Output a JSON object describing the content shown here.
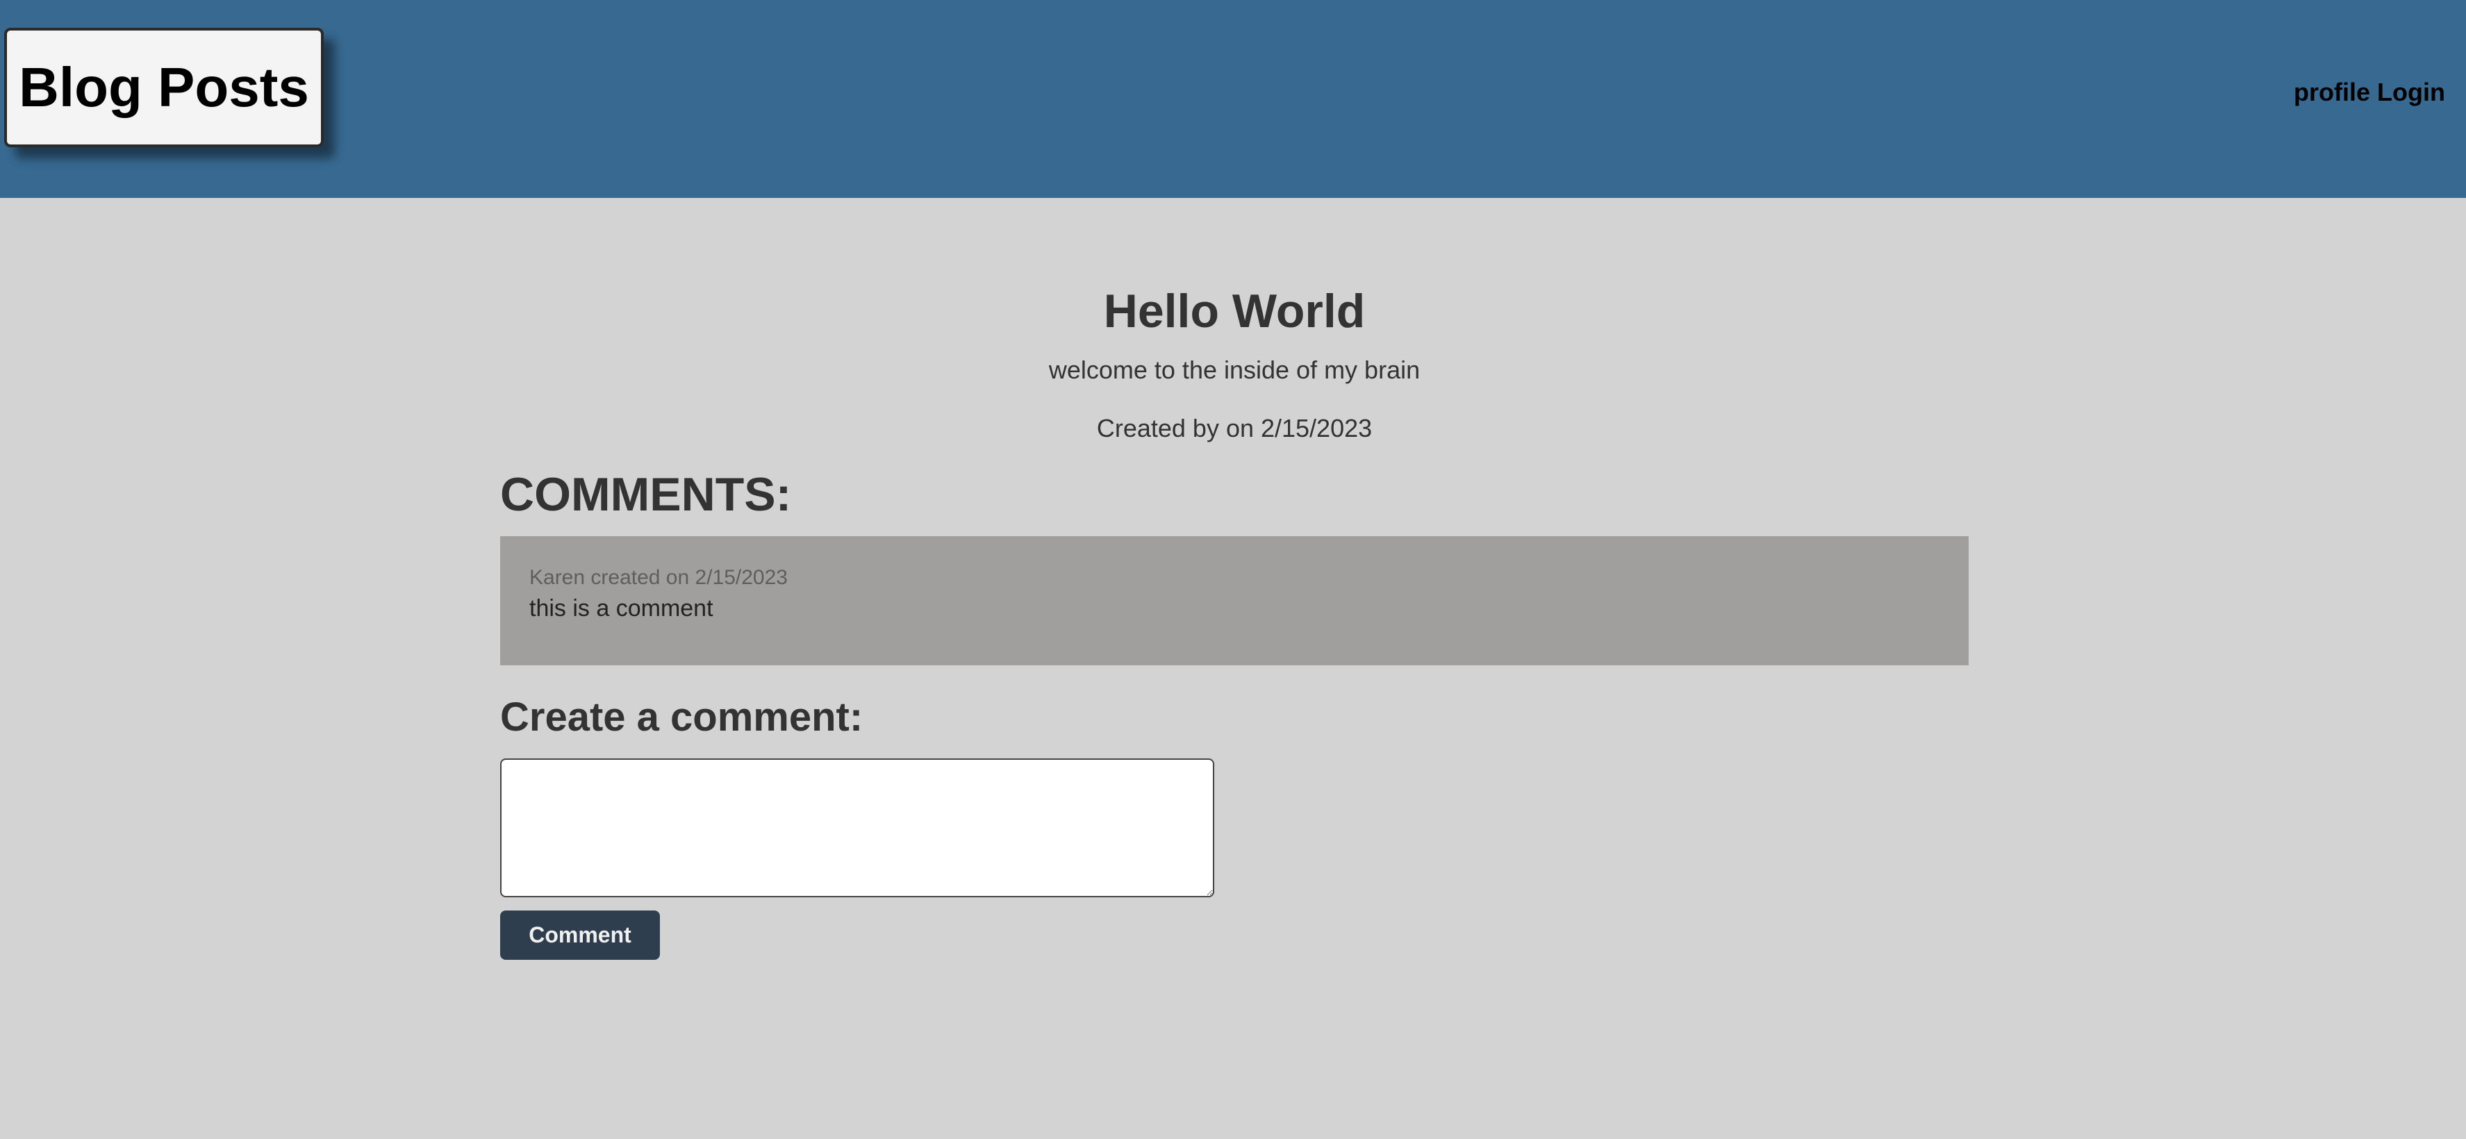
{
  "header": {
    "brand": "Blog Posts",
    "nav": {
      "profile": "profile",
      "login": "Login"
    },
    "background_color": "#376991"
  },
  "post": {
    "title": "Hello World",
    "subtitle": "welcome to the inside of my brain",
    "meta": "Created by on 2/15/2023"
  },
  "comments": {
    "heading": "COMMENTS:",
    "items": [
      {
        "meta": "Karen created on 2/15/2023",
        "body": "this is a comment"
      }
    ]
  },
  "create_comment": {
    "heading": "Create a comment:",
    "input_value": "",
    "button_label": "Comment",
    "button_color": "#2f3e4e"
  },
  "colors": {
    "page_background": "#d3d3d3",
    "comment_card": "#a09f9d",
    "text": "#333333"
  }
}
